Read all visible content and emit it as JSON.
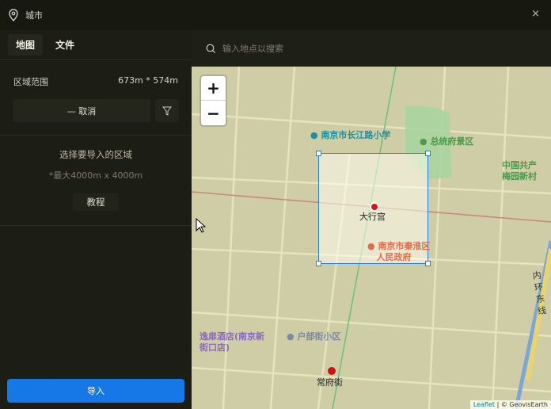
{
  "window": {
    "title": "城市",
    "close": "×"
  },
  "sidebar": {
    "tabs": [
      {
        "label": "地图",
        "active": true
      },
      {
        "label": "文件",
        "active": false
      }
    ],
    "range_label": "区域范围",
    "range_value": "673m * 574m",
    "cancel_label": "— 取消",
    "hint": "选择要导入的区域",
    "hint_limit": "*最大4000m x 4000m",
    "tutorial_label": "教程",
    "import_label": "导入"
  },
  "search": {
    "placeholder": "输入地点以搜索"
  },
  "map": {
    "zoom_in": "+",
    "zoom_out": "−",
    "labels": {
      "school": "南京市长江路小学",
      "scenic": "总统府景区",
      "cpc1": "中国共产",
      "cpc2": "梅园新村",
      "palace": "大行宫",
      "gov1": "南京市秦淮区",
      "gov2": "人民政府",
      "ring1": "内",
      "ring2": "环",
      "ring3": "东",
      "ring4": "线",
      "hotel1": "逸扉酒店(南京新",
      "hotel2": "街口店)",
      "hubu": "户部街小区",
      "changfu": "常府街"
    },
    "attribution": {
      "leaflet": "Leaflet",
      "provider": "| © GeovisEarth"
    },
    "selection_color": "#2a7fdc"
  }
}
